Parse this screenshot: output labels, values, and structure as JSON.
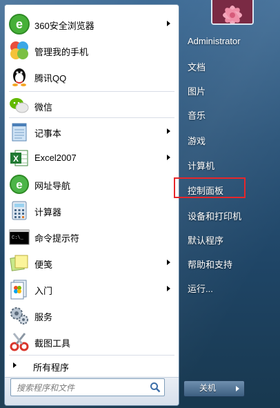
{
  "programs": [
    {
      "label": "360安全浏览器",
      "icon": "360-browser-icon",
      "submenu": true
    },
    {
      "label": "管理我的手机",
      "icon": "phone-manager-icon",
      "submenu": false
    },
    {
      "label": "腾讯QQ",
      "icon": "qq-penguin-icon",
      "submenu": false
    },
    {
      "label": "微信",
      "icon": "wechat-icon",
      "submenu": false
    },
    {
      "label": "记事本",
      "icon": "notepad-icon",
      "submenu": true
    },
    {
      "label": "Excel2007",
      "icon": "excel-icon",
      "submenu": true
    },
    {
      "label": "网址导航",
      "icon": "web-nav-icon",
      "submenu": false
    },
    {
      "label": "计算器",
      "icon": "calculator-icon",
      "submenu": false
    },
    {
      "label": "命令提示符",
      "icon": "cmd-icon",
      "submenu": false
    },
    {
      "label": "便笺",
      "icon": "sticky-notes-icon",
      "submenu": true
    },
    {
      "label": "入门",
      "icon": "getting-started-icon",
      "submenu": true
    },
    {
      "label": "服务",
      "icon": "services-gear-icon",
      "submenu": false
    },
    {
      "label": "截图工具",
      "icon": "snipping-tool-icon",
      "submenu": false
    }
  ],
  "all_programs_label": "所有程序",
  "search": {
    "placeholder": "搜索程序和文件"
  },
  "right_items": [
    {
      "label": "Administrator"
    },
    {
      "label": "文档"
    },
    {
      "label": "图片"
    },
    {
      "label": "音乐"
    },
    {
      "label": "游戏"
    },
    {
      "label": "计算机"
    },
    {
      "label": "控制面板"
    },
    {
      "label": "设备和打印机"
    },
    {
      "label": "默认程序"
    },
    {
      "label": "帮助和支持"
    },
    {
      "label": "运行..."
    }
  ],
  "shutdown_label": "关机",
  "colors": {
    "highlight": "#e8262a",
    "panel": "#ffffff",
    "background": "#2b5479"
  }
}
